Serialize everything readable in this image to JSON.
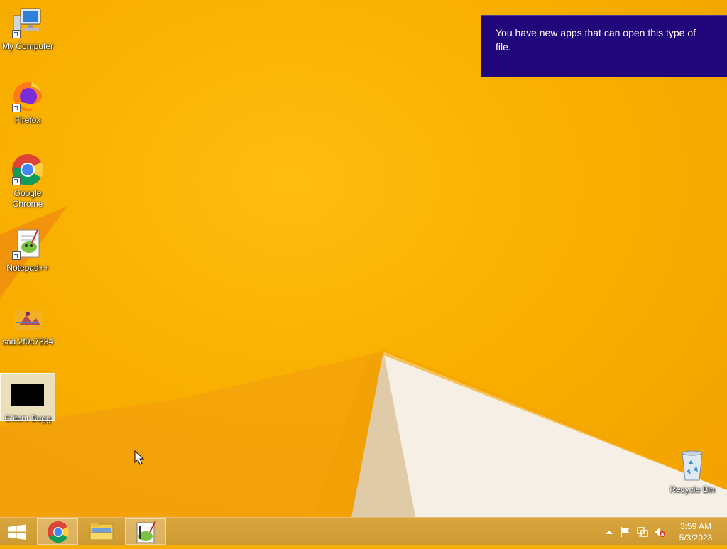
{
  "desktop": {
    "icons": [
      {
        "label": "My Computer",
        "icon": "computer-icon"
      },
      {
        "label": "Firefox",
        "icon": "firefox-icon"
      },
      {
        "label": "Google Chrome",
        "icon": "chrome-icon"
      },
      {
        "label": "Notepad++",
        "icon": "notepadpp-icon"
      },
      {
        "label": "sad.2f0c7334",
        "icon": "image-file-icon"
      },
      {
        "label": "Glitcht Bugg",
        "icon": "black-file-icon"
      }
    ],
    "recycle_bin": {
      "label": "Recycle Bin",
      "icon": "recycle-bin-icon"
    }
  },
  "notification": {
    "text": "You have new apps that can open this type of file.",
    "background": "#20067a"
  },
  "taskbar": {
    "start": {
      "icon": "windows-logo-icon"
    },
    "pinned": [
      {
        "name": "chrome",
        "icon": "chrome-icon",
        "active": true
      },
      {
        "name": "file-explorer",
        "icon": "folder-icon",
        "active": false
      },
      {
        "name": "notepadpp",
        "icon": "notepadpp-icon",
        "active": true
      }
    ],
    "tray": {
      "icons": [
        "show-hidden-icons-icon",
        "action-center-flag-icon",
        "network-icon",
        "volume-muted-icon"
      ],
      "time": "3:59 AM",
      "date": "5/3/2023"
    }
  },
  "colors": {
    "wallpaper": "#f9b000",
    "taskbar": "#d4a038",
    "toast": "#20067a"
  }
}
